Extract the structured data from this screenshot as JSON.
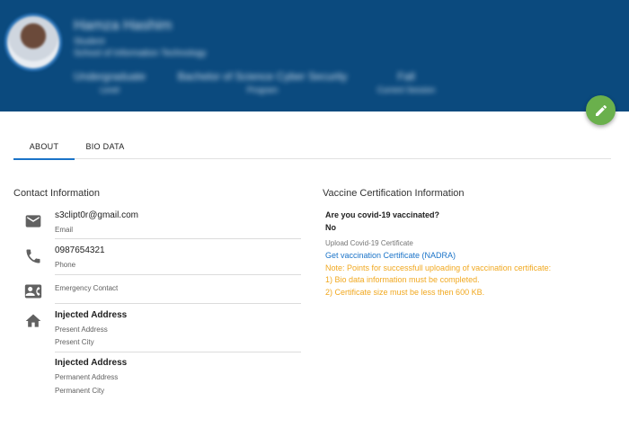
{
  "colors": {
    "header_bg": "#0b4a7e",
    "fab": "#6ab04c",
    "accent": "#1a73c8",
    "note": "#f1a81f"
  },
  "header": {
    "name": "Hamza Hashim",
    "role": "Student",
    "school": "School of Information Technology",
    "stats": [
      {
        "value": "Undergraduate",
        "label": "Level"
      },
      {
        "value": "Bachelor of Science Cyber Security",
        "label": "Program"
      },
      {
        "value": "Fall",
        "label": "Current Session"
      }
    ]
  },
  "tabs": [
    {
      "label": "ABOUT",
      "active": true
    },
    {
      "label": "BIO DATA",
      "active": false
    }
  ],
  "contact": {
    "title": "Contact Information",
    "email": {
      "value": "s3clipt0r@gmail.com",
      "label": "Email",
      "icon": "email-icon"
    },
    "phone": {
      "value": "0987654321",
      "label": "Phone",
      "icon": "phone-icon"
    },
    "emergency": {
      "label": "Emergency Contact",
      "icon": "contact-card-icon"
    },
    "present": {
      "value": "Injected Address",
      "line1": "Present Address",
      "line2": "Present City",
      "icon": "home-icon"
    },
    "permanent": {
      "value": "Injected Address",
      "line1": "Permanent Address",
      "line2": "Permanent City"
    }
  },
  "vaccine": {
    "title": "Vaccine Certification Information",
    "question": "Are you covid-19 vaccinated?",
    "answer": "No",
    "upload_label": "Upload Covid-19 Certificate",
    "link": "Get vaccination Certificate (NADRA)",
    "note": "Note: Points for successfull uploading of vaccination certificate:",
    "points": [
      "1) Bio data information must be completed.",
      "2) Certificate size must be less then 600 KB."
    ]
  }
}
